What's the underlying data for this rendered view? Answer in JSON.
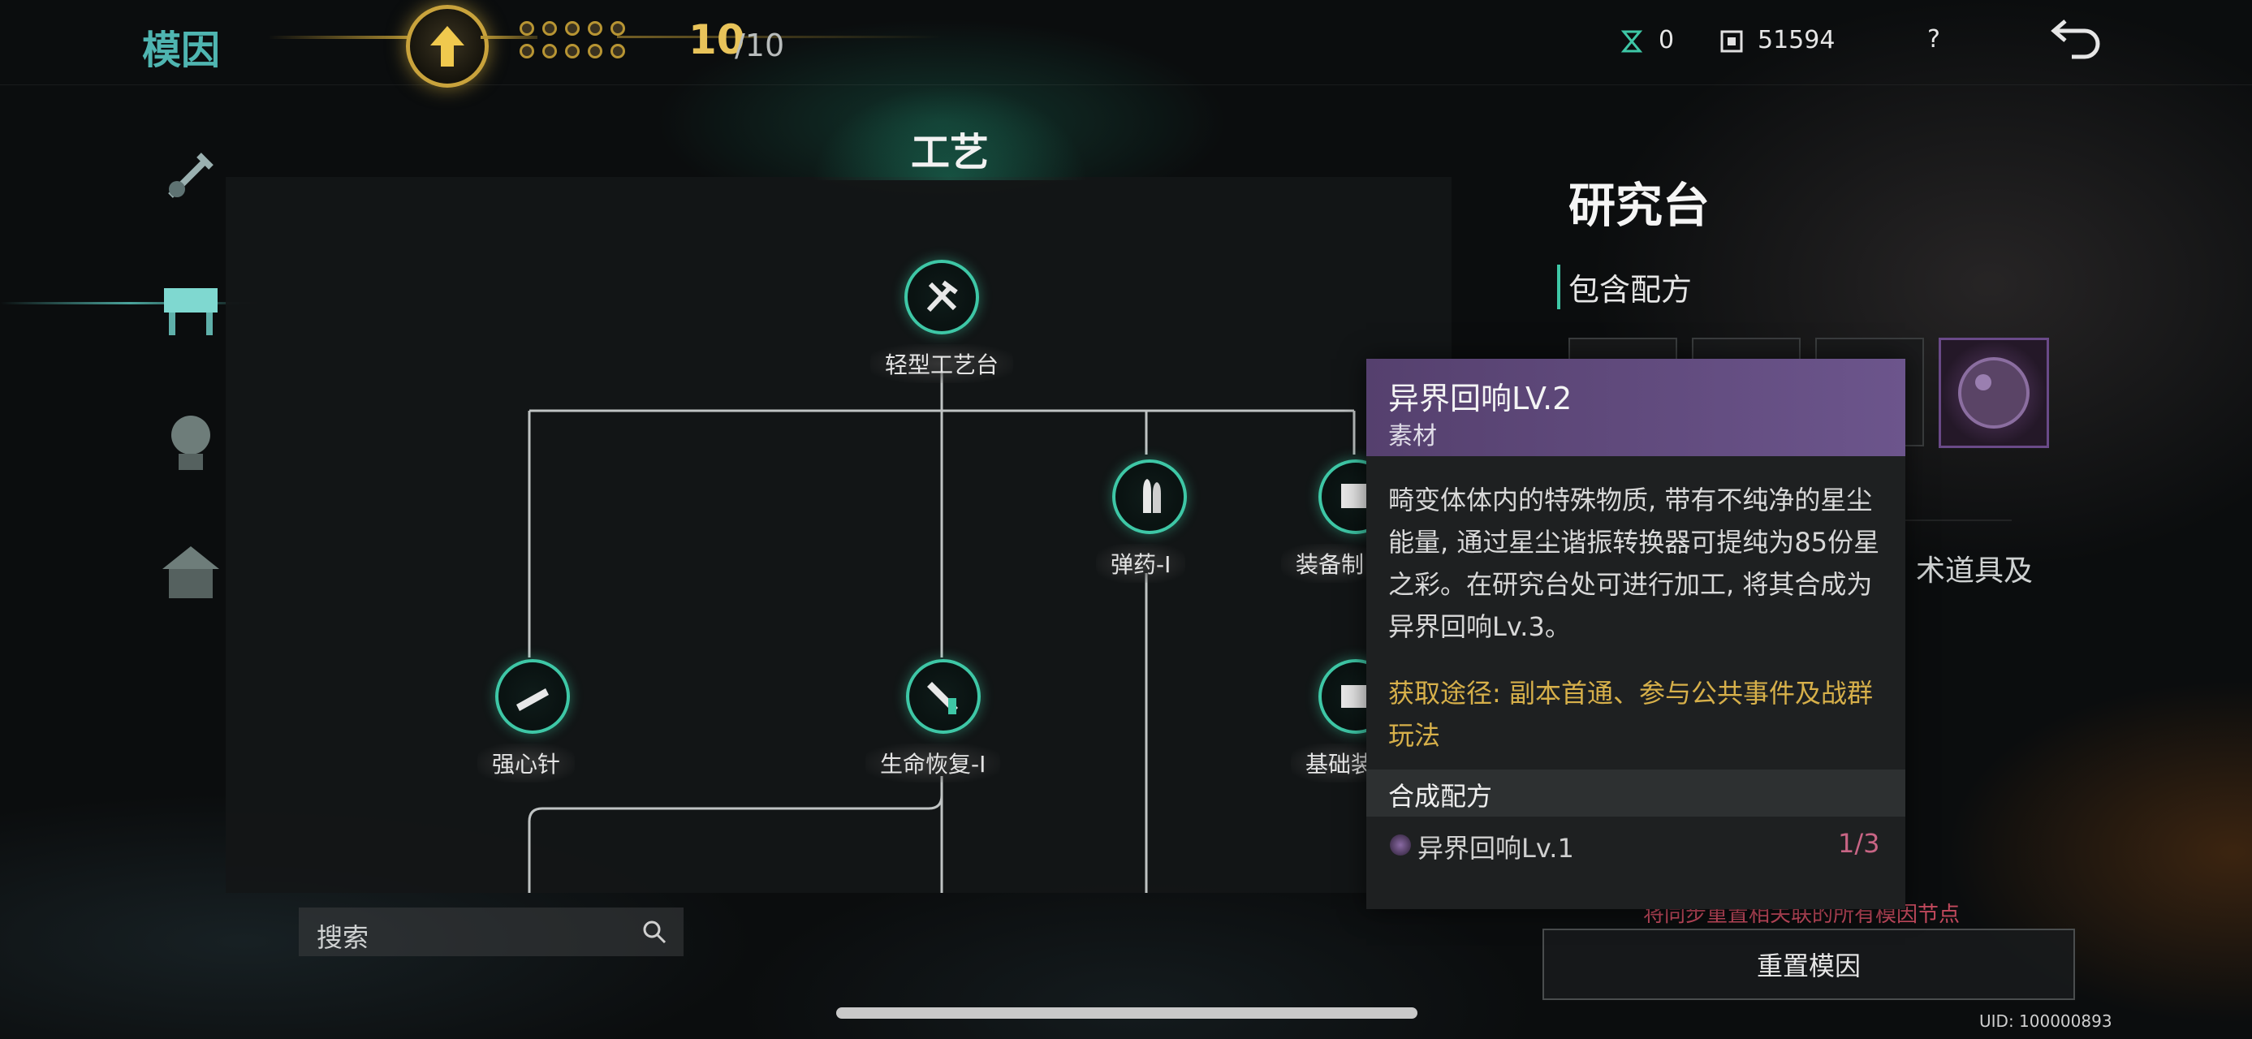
{
  "header": {
    "title": "模因",
    "level_current": "10",
    "level_max": "/10",
    "currency1_value": "0",
    "currency2_value": "51594",
    "help_label": "?"
  },
  "skill_tree": {
    "title": "工艺",
    "nodes": {
      "light_workbench": "轻型工艺台",
      "ammo_1": "弹药-I",
      "equipment": "装备制",
      "adrenaline": "强心针",
      "health_restore_1": "生命恢复-I",
      "basic": "基础装"
    }
  },
  "search": {
    "placeholder": "搜索"
  },
  "right_panel": {
    "title": "研究台",
    "section_label": "包含配方",
    "desc_fragment": "术道具及",
    "reset_warning": "将同步重置相关联的所有模因节点",
    "reset_button": "重置模因",
    "uid": "UID: 100000893"
  },
  "tooltip": {
    "name": "异界回响LV.2",
    "type": "素材",
    "description": "畸变体体内的特殊物质, 带有不纯净的星尘能量, 通过星尘谐振转换器可提纯为85份星之彩。在研究台处可进行加工, 将其合成为异界回响Lv.3。",
    "source": "获取途径: 副本首通、参与公共事件及战群玩法",
    "recipe_title": "合成配方",
    "ingredient_name": "异界回响Lv.1",
    "ingredient_count": "1/3"
  },
  "colors": {
    "accent_teal": "#3ec7a6",
    "gold": "#e8c35a",
    "tooltip_header": "#6c558c",
    "source_text": "#d7b04a",
    "count_text": "#c86585",
    "warning_text": "#c44a5e"
  },
  "icons": {
    "level_up": "arrow-up-icon",
    "currency1": "hourglass-icon",
    "currency2": "crystal-icon",
    "back": "return-arrow-icon",
    "search": "search-icon"
  }
}
